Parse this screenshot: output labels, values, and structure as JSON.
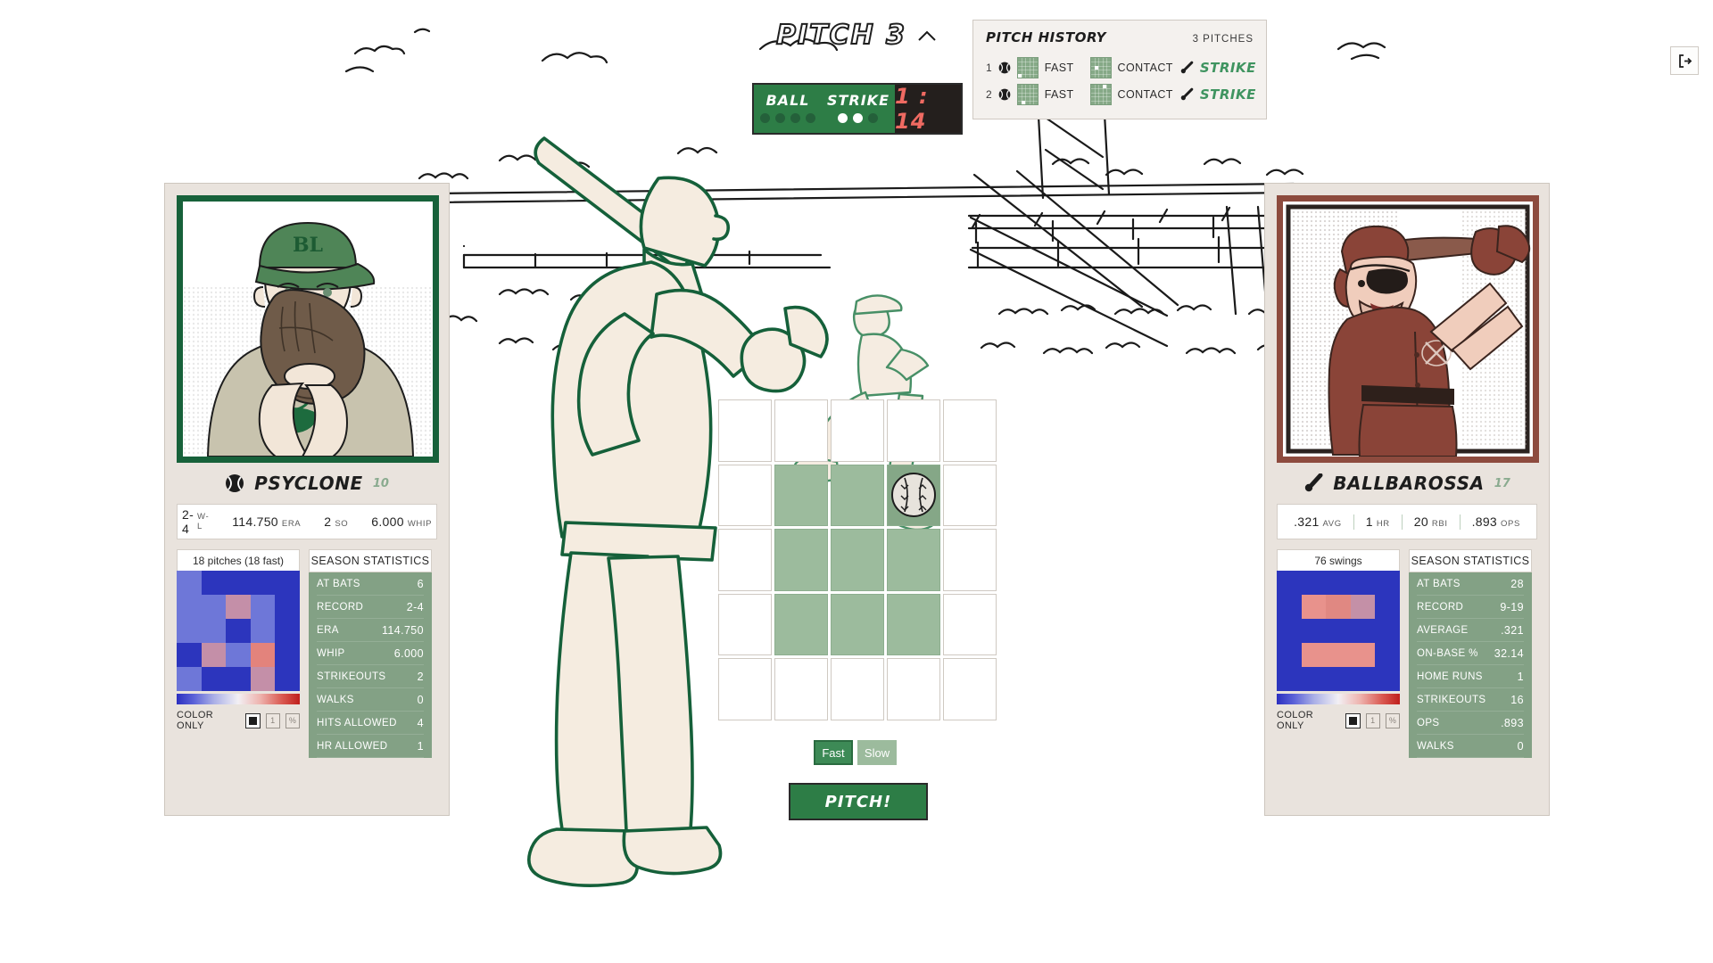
{
  "header": {
    "pitch_label": "PITCH 3",
    "chevron_icon": "chevron-up-icon",
    "exit_icon": "exit-icon"
  },
  "count_board": {
    "ball_label": "BALL",
    "strike_label": "STRIKE",
    "balls_total": 4,
    "balls_filled": 0,
    "strikes_total": 3,
    "strikes_filled": 2,
    "timer": "1 : 14"
  },
  "pitch_history": {
    "title": "PITCH HISTORY",
    "count_label": "3 PITCHES",
    "rows": [
      {
        "index": "1",
        "pitch_icon": "baseball-icon",
        "pitch_type": "FAST",
        "pitch_cell": {
          "col": 0,
          "row": 4
        },
        "swing_type": "CONTACT",
        "bat_icon": "bat-icon",
        "swing_cell": {
          "col": 1,
          "row": 2
        },
        "result": "STRIKE"
      },
      {
        "index": "2",
        "pitch_icon": "baseball-icon",
        "pitch_type": "FAST",
        "pitch_cell": {
          "col": 1,
          "row": 4
        },
        "swing_type": "CONTACT",
        "bat_icon": "bat-icon",
        "swing_cell": {
          "col": 3,
          "row": 0
        },
        "result": "STRIKE"
      }
    ]
  },
  "pitcher_card": {
    "role_icon": "baseball-icon",
    "name": "PSYCLONE",
    "number": "10",
    "portrait_alt": "pitcher-portrait",
    "accent_color": "#17613a",
    "quick_stats": [
      {
        "value": "2-4",
        "key": "W-L"
      },
      {
        "value": "114.750",
        "key": "ERA"
      },
      {
        "value": "2",
        "key": "SO"
      },
      {
        "value": "6.000",
        "key": "WHIP"
      }
    ],
    "heatmap": {
      "title": "18 pitches (18 fast)",
      "legend_label": "COLOR ONLY",
      "toggles": [
        "color-swatch",
        "1",
        "%"
      ],
      "active_toggle": 0,
      "cells": [
        "#6e77d8",
        "#2c35bd",
        "#2c35bd",
        "#2c35bd",
        "#2c35bd",
        "#6e77d8",
        "#6e77d8",
        "#c48fa8",
        "#6e77d8",
        "#2c35bd",
        "#6e77d8",
        "#6e77d8",
        "#2c35bd",
        "#6e77d8",
        "#2c35bd",
        "#2c35bd",
        "#c48fa8",
        "#6e77d8",
        "#e3837c",
        "#2c35bd",
        "#6e77d8",
        "#2c35bd",
        "#2c35bd",
        "#c48fa8",
        "#2c35bd"
      ]
    },
    "season": {
      "title": "SEASON STATISTICS",
      "rows": [
        {
          "label": "AT BATS",
          "value": "6"
        },
        {
          "label": "RECORD",
          "value": "2-4"
        },
        {
          "label": "ERA",
          "value": "114.750"
        },
        {
          "label": "WHIP",
          "value": "6.000"
        },
        {
          "label": "STRIKEOUTS",
          "value": "2"
        },
        {
          "label": "WALKS",
          "value": "0"
        },
        {
          "label": "HITS ALLOWED",
          "value": "4"
        },
        {
          "label": "HR ALLOWED",
          "value": "1"
        }
      ]
    }
  },
  "batter_card": {
    "role_icon": "bat-icon",
    "name": "BALLBAROSSA",
    "number": "17",
    "portrait_alt": "batter-portrait",
    "accent_color": "#8d4b3e",
    "quick_stats": [
      {
        "value": ".321",
        "key": "AVG"
      },
      {
        "value": "1",
        "key": "HR"
      },
      {
        "value": "20",
        "key": "RBI"
      },
      {
        "value": ".893",
        "key": "OPS"
      }
    ],
    "heatmap": {
      "title": "76 swings",
      "legend_label": "COLOR ONLY",
      "toggles": [
        "color-swatch",
        "1",
        "%"
      ],
      "active_toggle": 0,
      "cells": [
        "#2c35bd",
        "#2c35bd",
        "#2c35bd",
        "#2c35bd",
        "#2c35bd",
        "#2c35bd",
        "#e8928c",
        "#e08882",
        "#c490a7",
        "#2c35bd",
        "#2c35bd",
        "#2c35bd",
        "#2c35bd",
        "#2c35bd",
        "#2c35bd",
        "#2c35bd",
        "#e8928c",
        "#e8928c",
        "#e8928c",
        "#2c35bd",
        "#2c35bd",
        "#2c35bd",
        "#2c35bd",
        "#2c35bd",
        "#2c35bd"
      ]
    },
    "season": {
      "title": "SEASON STATISTICS",
      "rows": [
        {
          "label": "AT BATS",
          "value": "28"
        },
        {
          "label": "RECORD",
          "value": "9-19"
        },
        {
          "label": "AVERAGE",
          "value": ".321"
        },
        {
          "label": "ON-BASE %",
          "value": "32.14"
        },
        {
          "label": "HOME RUNS",
          "value": "1"
        },
        {
          "label": "STRIKEOUTS",
          "value": "16"
        },
        {
          "label": "OPS",
          "value": ".893"
        },
        {
          "label": "WALKS",
          "value": "0"
        }
      ]
    }
  },
  "strike_zone": {
    "cols": 5,
    "rows": 5,
    "inner": {
      "col_from": 1,
      "col_to": 3,
      "row_from": 1,
      "row_to": 3
    },
    "ball_cell": {
      "col": 3,
      "row": 1
    },
    "ball_icon": "baseball-icon"
  },
  "actions": {
    "speeds": [
      {
        "label": "Fast",
        "active": true
      },
      {
        "label": "Slow",
        "active": false
      }
    ],
    "pitch_button": "PITCH!"
  },
  "colors": {
    "green": "#2d7d46",
    "zone_green": "#9cbb9d",
    "card_bg": "#e9e3dd",
    "timer_red": "#ef6a62",
    "pitcher_accent": "#17613a",
    "batter_accent": "#8d4b3e"
  }
}
